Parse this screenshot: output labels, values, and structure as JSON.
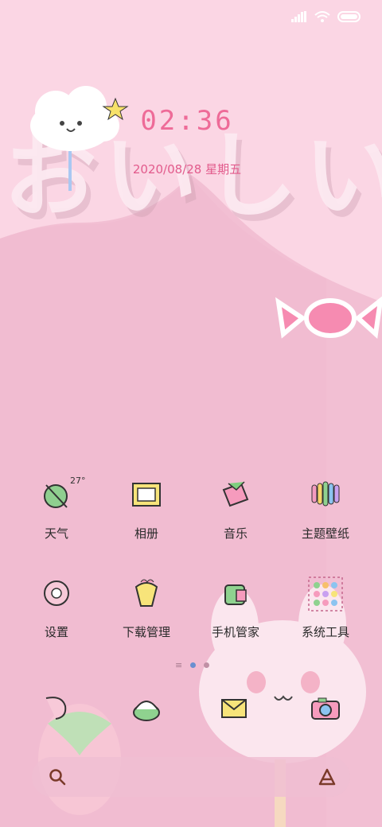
{
  "status_bar": {
    "signal_icon": "cellular-signal-icon",
    "wifi_icon": "wifi-icon",
    "battery_icon": "battery-icon"
  },
  "lock_widget": {
    "time": "02:36",
    "date": "2020/08/28 星期五"
  },
  "wallpaper": {
    "decoration_text": "おいしい",
    "accent": "#ee6b98",
    "background": "#f2bfd3"
  },
  "weather": {
    "temperature": "27°"
  },
  "apps": [
    {
      "label": "天气",
      "icon": "weather-icon"
    },
    {
      "label": "相册",
      "icon": "gallery-icon"
    },
    {
      "label": "音乐",
      "icon": "music-icon"
    },
    {
      "label": "主题壁纸",
      "icon": "themes-icon"
    },
    {
      "label": "设置",
      "icon": "settings-icon"
    },
    {
      "label": "下载管理",
      "icon": "downloads-icon"
    },
    {
      "label": "手机管家",
      "icon": "security-icon"
    },
    {
      "label": "系统工具",
      "icon": "tools-folder-icon"
    }
  ],
  "dock": [
    {
      "icon": "phone-icon"
    },
    {
      "icon": "browser-icon"
    },
    {
      "icon": "messages-icon"
    },
    {
      "icon": "camera-icon"
    }
  ],
  "search_bar": {
    "search_icon": "search-icon",
    "assistant_icon": "assistant-icon"
  }
}
